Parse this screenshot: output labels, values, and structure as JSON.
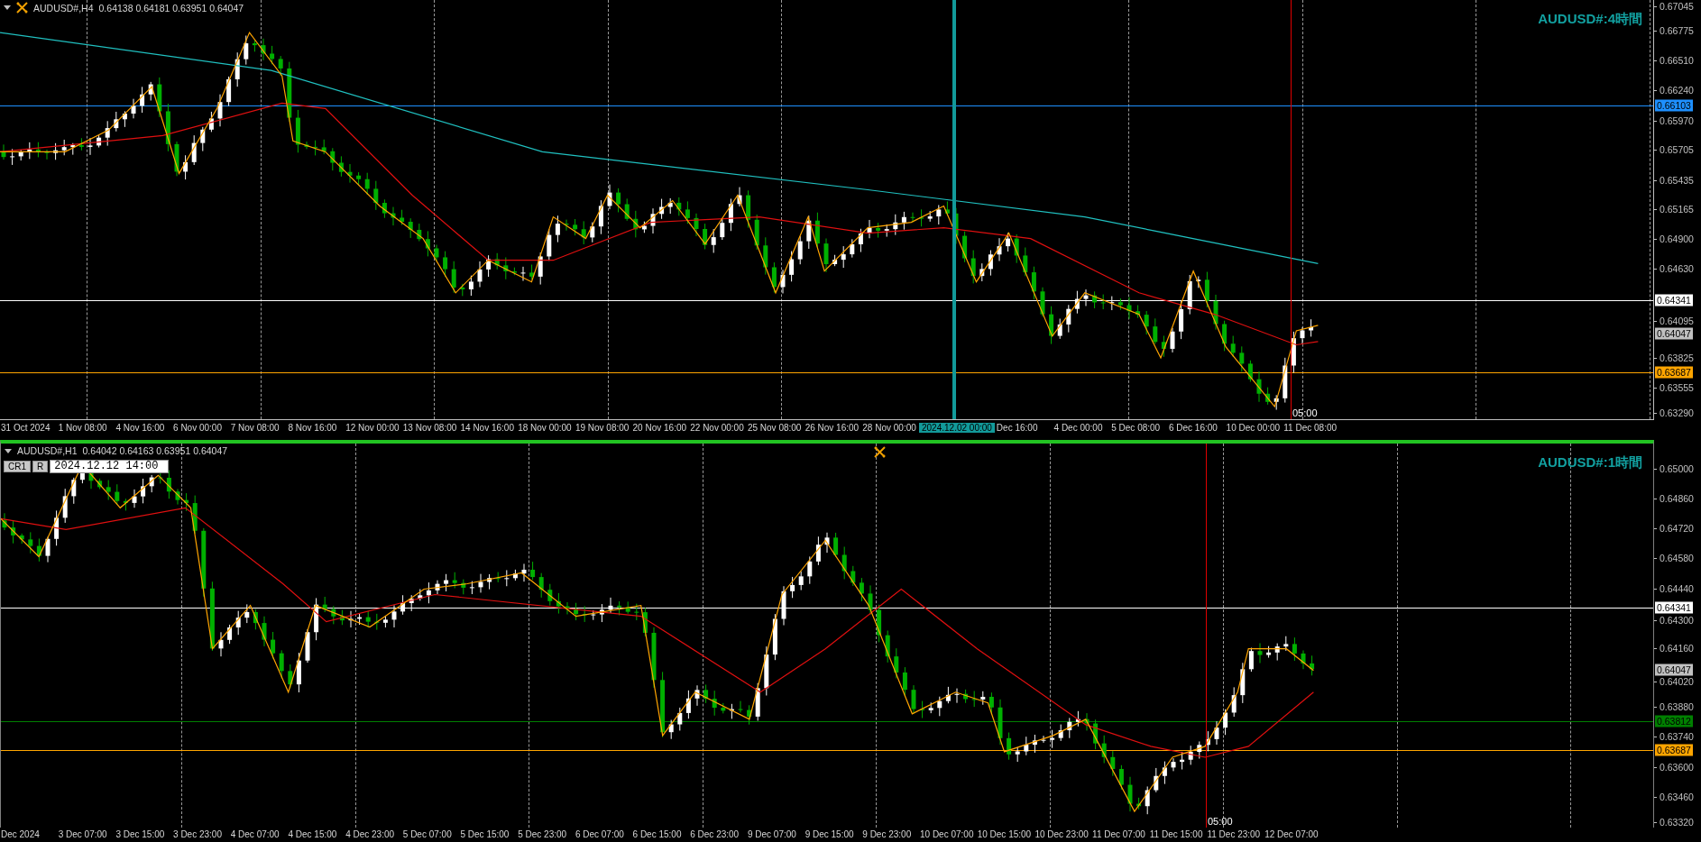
{
  "panes": [
    {
      "symbol": "AUDUSD#,H4",
      "ohlc": "0.64138 0.64181 0.63951 0.64047",
      "title": "AUDUSD#:4時間",
      "selected": false,
      "price_ticks": [
        "0.67045",
        "0.66775",
        "0.66510",
        "0.66240",
        "0.65970",
        "0.65705",
        "0.65435",
        "0.65165",
        "0.64900",
        "0.64630",
        "0.64095",
        "0.63825",
        "0.63555",
        "0.63290"
      ],
      "price_labels": [
        {
          "text": "0.66103",
          "color": "#1e90ff",
          "line": true
        },
        {
          "text": "0.64341",
          "color": "#ffffff",
          "line": true
        },
        {
          "text": "0.64047",
          "color": "#c0c0c0",
          "line": false
        },
        {
          "text": "0.63687",
          "color": "#ffa500",
          "line": true
        }
      ],
      "time_labels": [
        {
          "text": "31 Oct 2024",
          "highlighted": false
        },
        {
          "text": "1 Nov 08:00",
          "highlighted": false
        },
        {
          "text": "4 Nov 16:00",
          "highlighted": false
        },
        {
          "text": "6 Nov 00:00",
          "highlighted": false
        },
        {
          "text": "7 Nov 08:00",
          "highlighted": false
        },
        {
          "text": "8 Nov 16:00",
          "highlighted": false
        },
        {
          "text": "12 Nov 00:00",
          "highlighted": false
        },
        {
          "text": "13 Nov 08:00",
          "highlighted": false
        },
        {
          "text": "14 Nov 16:00",
          "highlighted": false
        },
        {
          "text": "18 Nov 00:00",
          "highlighted": false
        },
        {
          "text": "19 Nov 08:00",
          "highlighted": false
        },
        {
          "text": "20 Nov 16:00",
          "highlighted": false
        },
        {
          "text": "22 Nov 00:00",
          "highlighted": false
        },
        {
          "text": "25 Nov 08:00",
          "highlighted": false
        },
        {
          "text": "26 Nov 16:00",
          "highlighted": false
        },
        {
          "text": "28 Nov 00:00",
          "highlighted": false
        },
        {
          "text": "2024.12.02 00:00",
          "highlighted": true
        },
        {
          "text": "Dec 16:00",
          "highlighted": false
        },
        {
          "text": "4 Dec 00:00",
          "highlighted": false
        },
        {
          "text": "5 Dec 08:00",
          "highlighted": false
        },
        {
          "text": "6 Dec 16:00",
          "highlighted": false
        },
        {
          "text": "10 Dec 00:00",
          "highlighted": false
        },
        {
          "text": "11 Dec 08:00",
          "highlighted": false
        }
      ],
      "cursor_label": "05:00"
    },
    {
      "symbol": "AUDUSD#,H1",
      "ohlc": "0.64042 0.64163 0.63951 0.64047",
      "title": "AUDUSD#:1時間",
      "selected": true,
      "tools": [
        "CR1",
        "R"
      ],
      "date_field": "2024.12.12 14:00",
      "price_ticks": [
        "0.65000",
        "0.64860",
        "0.64720",
        "0.64580",
        "0.64440",
        "0.64300",
        "0.64160",
        "0.64020",
        "0.63880",
        "0.63740",
        "0.63600",
        "0.63460",
        "0.63320"
      ],
      "price_labels": [
        {
          "text": "0.64341",
          "color": "#ffffff",
          "line": true
        },
        {
          "text": "0.64047",
          "color": "#c0c0c0",
          "line": false
        },
        {
          "text": "0.63812",
          "color": "#008000",
          "line": true
        },
        {
          "text": "0.63687",
          "color": "#ffa500",
          "line": true
        }
      ],
      "time_labels": [
        {
          "text": "Dec 2024",
          "highlighted": false
        },
        {
          "text": "3 Dec 07:00",
          "highlighted": false
        },
        {
          "text": "3 Dec 15:00",
          "highlighted": false
        },
        {
          "text": "3 Dec 23:00",
          "highlighted": false
        },
        {
          "text": "4 Dec 07:00",
          "highlighted": false
        },
        {
          "text": "4 Dec 15:00",
          "highlighted": false
        },
        {
          "text": "4 Dec 23:00",
          "highlighted": false
        },
        {
          "text": "5 Dec 07:00",
          "highlighted": false
        },
        {
          "text": "5 Dec 15:00",
          "highlighted": false
        },
        {
          "text": "5 Dec 23:00",
          "highlighted": false
        },
        {
          "text": "6 Dec 07:00",
          "highlighted": false
        },
        {
          "text": "6 Dec 15:00",
          "highlighted": false
        },
        {
          "text": "6 Dec 23:00",
          "highlighted": false
        },
        {
          "text": "9 Dec 07:00",
          "highlighted": false
        },
        {
          "text": "9 Dec 15:00",
          "highlighted": false
        },
        {
          "text": "9 Dec 23:00",
          "highlighted": false
        },
        {
          "text": "10 Dec 07:00",
          "highlighted": false
        },
        {
          "text": "10 Dec 15:00",
          "highlighted": false
        },
        {
          "text": "10 Dec 23:00",
          "highlighted": false
        },
        {
          "text": "11 Dec 07:00",
          "highlighted": false
        },
        {
          "text": "11 Dec 15:00",
          "highlighted": false
        },
        {
          "text": "11 Dec 23:00",
          "highlighted": false
        },
        {
          "text": "12 Dec 07:00",
          "highlighted": false
        }
      ],
      "cursor_label": "05:00"
    }
  ]
}
